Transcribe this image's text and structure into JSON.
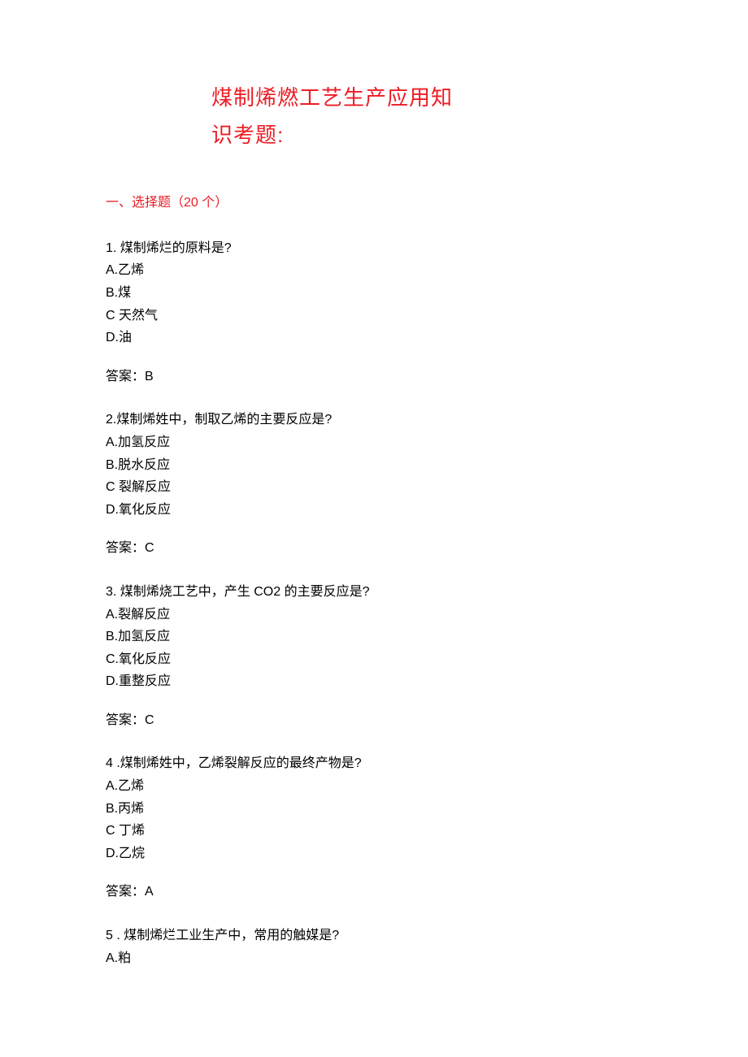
{
  "title_line1": "煤制烯燃工艺生产应用知",
  "title_line2": "识考题:",
  "section_header": "一、选择题（20 个）",
  "questions": [
    {
      "q": "1. 煤制烯烂的原料是?",
      "options": [
        "A.乙烯",
        "B.煤",
        "C 天然气",
        "D.油"
      ],
      "answer": "答案：B"
    },
    {
      "q": "2.煤制烯姓中，制取乙烯的主要反应是?",
      "options": [
        "A.加氢反应",
        "B.脱水反应",
        "C 裂解反应",
        "D.氧化反应"
      ],
      "answer": "答案：C"
    },
    {
      "q": "3. 煤制烯烧工艺中，产生 CO2 的主要反应是?",
      "options": [
        "A.裂解反应",
        "B.加氢反应",
        "C.氧化反应",
        "D.重整反应"
      ],
      "answer": "答案：C"
    },
    {
      "q": "4    .煤制烯姓中，乙烯裂解反应的最终产物是?",
      "options": [
        "A.乙烯",
        "B.丙烯",
        "C 丁烯",
        "D.乙烷"
      ],
      "answer": "答案：A"
    },
    {
      "q": "5    . 煤制烯烂工业生产中，常用的触媒是?",
      "options": [
        "A.粕"
      ],
      "answer": ""
    }
  ]
}
